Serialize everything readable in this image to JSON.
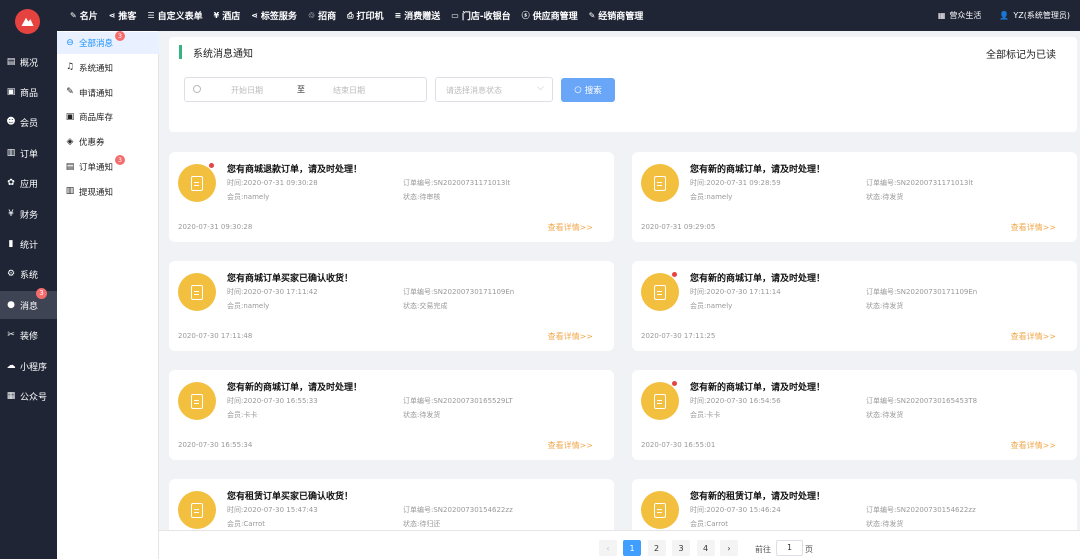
{
  "colors": {
    "dark": "#1f2535",
    "accent": "#409eff",
    "badge": "#f56c6c",
    "avatar": "#f3bf3f",
    "detail_link": "#f0a84c",
    "title_bar": "#36b37e"
  },
  "topnav": [
    {
      "label": "名片",
      "icon": "card-icon",
      "glyph": "✎"
    },
    {
      "label": "推客",
      "icon": "share-icon",
      "glyph": "⋖"
    },
    {
      "label": "自定义表单",
      "icon": "form-icon",
      "glyph": "☰"
    },
    {
      "label": "酒店",
      "icon": "yen-icon",
      "glyph": "¥"
    },
    {
      "label": "标签服务",
      "icon": "share-icon",
      "glyph": "⋖"
    },
    {
      "label": "招商",
      "icon": "recycle-icon",
      "glyph": "♲"
    },
    {
      "label": "打印机",
      "icon": "printer-icon",
      "glyph": "⎙"
    },
    {
      "label": "消费赠送",
      "icon": "list-icon",
      "glyph": "≡"
    },
    {
      "label": "门店-收银台",
      "icon": "cashier-icon",
      "glyph": "▭"
    },
    {
      "label": "供应商管理",
      "icon": "supplier-icon",
      "glyph": "ⓢ"
    },
    {
      "label": "经销商管理",
      "icon": "dealer-icon",
      "glyph": "✎"
    }
  ],
  "topright": {
    "store": "营众生活",
    "user": "YZ(系统管理员)"
  },
  "sidebar": [
    {
      "label": "概况",
      "icon": "overview-icon",
      "glyph": "▤"
    },
    {
      "label": "商品",
      "icon": "goods-icon",
      "glyph": "▣"
    },
    {
      "label": "会员",
      "icon": "members-icon",
      "glyph": "☻"
    },
    {
      "label": "订单",
      "icon": "order-icon",
      "glyph": "▥"
    },
    {
      "label": "应用",
      "icon": "apps-icon",
      "glyph": "✿"
    },
    {
      "label": "财务",
      "icon": "finance-icon",
      "glyph": "¥"
    },
    {
      "label": "统计",
      "icon": "stats-icon",
      "glyph": "▮"
    },
    {
      "label": "系统",
      "icon": "settings-icon",
      "glyph": "⚙"
    },
    {
      "label": "消息",
      "icon": "message-icon",
      "glyph": "●",
      "badge": "3",
      "active": true
    },
    {
      "label": "装修",
      "icon": "decorate-icon",
      "glyph": "✂"
    },
    {
      "label": "小程序",
      "icon": "miniprogram-icon",
      "glyph": "☁"
    },
    {
      "label": "公众号",
      "icon": "official-account-icon",
      "glyph": "▦"
    }
  ],
  "submenu": [
    {
      "label": "全部消息",
      "icon": "all-messages-icon",
      "glyph": "⊖",
      "badge": "3",
      "active": true
    },
    {
      "label": "系统通知",
      "icon": "bell-icon",
      "glyph": "♫"
    },
    {
      "label": "申请通知",
      "icon": "apply-icon",
      "glyph": "✎"
    },
    {
      "label": "商品库存",
      "icon": "inventory-icon",
      "glyph": "▣"
    },
    {
      "label": "优惠券",
      "icon": "coupon-icon",
      "glyph": "◈"
    },
    {
      "label": "订单通知",
      "icon": "order-notice-icon",
      "glyph": "▤",
      "badge": "3"
    },
    {
      "label": "提现通知",
      "icon": "withdraw-icon",
      "glyph": "▥"
    }
  ],
  "header": {
    "title": "系统消息通知",
    "mark_all_read": "全部标记为已读"
  },
  "filter": {
    "start_placeholder": "开始日期",
    "separator": "至",
    "end_placeholder": "结束日期",
    "status_placeholder": "请选择消息状态",
    "search_label": "搜索"
  },
  "messages": [
    {
      "title": "您有商城退款订单，请及时处理！",
      "time": "时间:2020-07-31 09:30:28",
      "order": "订单编号:SN20200731171013lt",
      "member": "会员:namely",
      "status": "状态:待审核",
      "timestamp": "2020-07-31 09:30:28",
      "detail": "查看详情>>",
      "unread": true
    },
    {
      "title": "您有新的商城订单，请及时处理！",
      "time": "时间:2020-07-31 09:28:59",
      "order": "订单编号:SN20200731171013lt",
      "member": "会员:namely",
      "status": "状态:待发货",
      "timestamp": "2020-07-31 09:29:05",
      "detail": "查看详情>>",
      "unread": false
    },
    {
      "title": "您有商城订单买家已确认收货！",
      "time": "时间:2020-07-30 17:11:42",
      "order": "订单编号:SN20200730171109En",
      "member": "会员:namely",
      "status": "状态:交易完成",
      "timestamp": "2020-07-30 17:11:48",
      "detail": "查看详情>>",
      "unread": false
    },
    {
      "title": "您有新的商城订单，请及时处理！",
      "time": "时间:2020-07-30 17:11:14",
      "order": "订单编号:SN20200730171109En",
      "member": "会员:namely",
      "status": "状态:待发货",
      "timestamp": "2020-07-30 17:11:25",
      "detail": "查看详情>>",
      "unread": true
    },
    {
      "title": "您有新的商城订单，请及时处理！",
      "time": "时间:2020-07-30 16:55:33",
      "order": "订单编号:SN20200730165529LT",
      "member": "会员:卡卡",
      "status": "状态:待发货",
      "timestamp": "2020-07-30 16:55:34",
      "detail": "查看详情>>",
      "unread": false
    },
    {
      "title": "您有新的商城订单，请及时处理！",
      "time": "时间:2020-07-30 16:54:56",
      "order": "订单编号:SN20200730165453T8",
      "member": "会员:卡卡",
      "status": "状态:待发货",
      "timestamp": "2020-07-30 16:55:01",
      "detail": "查看详情>>",
      "unread": true
    },
    {
      "title": "您有租赁订单买家已确认收货！",
      "time": "时间:2020-07-30 15:47:43",
      "order": "订单编号:SN20200730154622zz",
      "member": "会员:Carrot",
      "status": "状态:待归还",
      "timestamp": "",
      "detail": "",
      "unread": false
    },
    {
      "title": "您有新的租赁订单，请及时处理！",
      "time": "时间:2020-07-30 15:46:24",
      "order": "订单编号:SN20200730154622zz",
      "member": "会员:Carrot",
      "status": "状态:待发货",
      "timestamp": "",
      "detail": "",
      "unread": false
    }
  ],
  "pagination": {
    "prev": "‹",
    "next": "›",
    "pages": [
      "1",
      "2",
      "3",
      "4"
    ],
    "current": "1",
    "goto_prefix": "前往",
    "goto_value": "1",
    "goto_suffix": "页"
  }
}
